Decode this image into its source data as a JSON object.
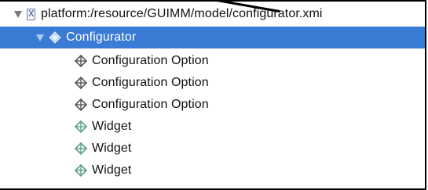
{
  "tree": {
    "root": {
      "label": "platform:/resource/GUIMM/model/configurator.xmi",
      "icon": "xmi-file-icon"
    },
    "selected": {
      "label": "Configurator",
      "icon": "model-element-icon"
    },
    "children": [
      {
        "label": "Configuration Option",
        "icon": "configuration-option-icon"
      },
      {
        "label": "Configuration Option",
        "icon": "configuration-option-icon"
      },
      {
        "label": "Configuration Option",
        "icon": "configuration-option-icon"
      },
      {
        "label": "Widget",
        "icon": "widget-icon"
      },
      {
        "label": "Widget",
        "icon": "widget-icon"
      },
      {
        "label": "Widget",
        "icon": "widget-icon"
      }
    ]
  },
  "colors": {
    "selection": "#3a7bd5",
    "option_icon": "#555555",
    "widget_icon": "#5aa08a"
  }
}
